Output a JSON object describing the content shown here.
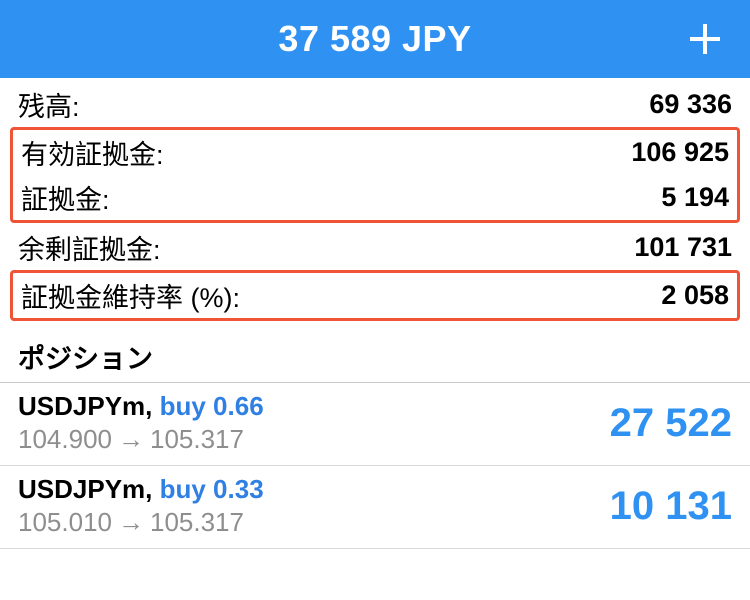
{
  "header": {
    "title": "37 589 JPY"
  },
  "summary": {
    "rows": [
      {
        "label": "残高:",
        "value": "69 336"
      },
      {
        "label": "有効証拠金:",
        "value": "106 925"
      },
      {
        "label": "証拠金:",
        "value": "5 194"
      },
      {
        "label": "余剰証拠金:",
        "value": "101 731"
      },
      {
        "label": "証拠金維持率 (%):",
        "value": "2 058"
      }
    ]
  },
  "positions_header": "ポジション",
  "positions": [
    {
      "symbol": "USDJPYm",
      "order": "buy 0.66",
      "open_price": "104.900",
      "current_price": "105.317",
      "profit": "27 522"
    },
    {
      "symbol": "USDJPYm",
      "order": "buy 0.33",
      "open_price": "105.010",
      "current_price": "105.317",
      "profit": "10 131"
    }
  ]
}
